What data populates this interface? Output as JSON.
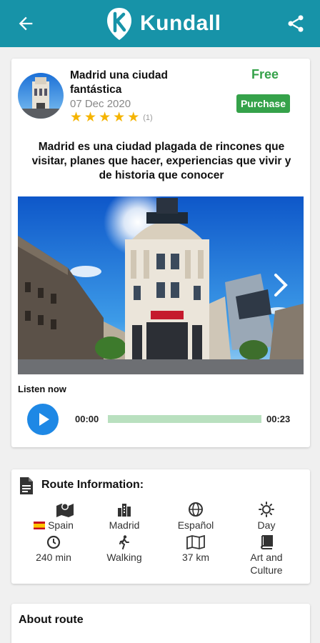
{
  "app": {
    "brand": "Kundall"
  },
  "route": {
    "title": "Madrid una ciudad fantástica",
    "date": "07 Dec 2020",
    "rating": 5,
    "rating_count": "(1)",
    "price": "Free",
    "purchase_label": "Purchase",
    "description": "Madrid es una ciudad plagada de rincones que visitar, planes que hacer, experiencias que vivir y de historia que conocer"
  },
  "audio": {
    "listen_label": "Listen now",
    "current_time": "00:00",
    "duration": "00:23",
    "progress": 0
  },
  "info": {
    "heading": "Route Information:",
    "country": "Spain",
    "city": "Madrid",
    "language": "Español",
    "time_of_day": "Day",
    "duration": "240 min",
    "mode": "Walking",
    "distance": "37 km",
    "category": "Art and Culture"
  },
  "about": {
    "heading": "About route"
  },
  "colors": {
    "appbar": "#1793a8",
    "accent_green": "#35a24a",
    "play_blue": "#1e88e5",
    "star": "#f5b400",
    "track": "#b9e0bf"
  }
}
